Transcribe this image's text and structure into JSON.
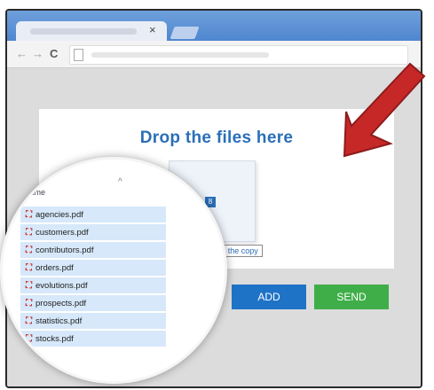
{
  "drop_zone": {
    "title": "Drop the files here",
    "file_chip": "8",
    "copy_hint": "the copy",
    "copy_symbol": "+"
  },
  "buttons": {
    "add": "ADD",
    "send": "SEND"
  },
  "file_list": {
    "header": "Name",
    "files": [
      "agencies.pdf",
      "customers.pdf",
      "contributors.pdf",
      "orders.pdf",
      "evolutions.pdf",
      "prospects.pdf",
      "statistics.pdf",
      "stocks.pdf"
    ]
  },
  "colors": {
    "accent_blue": "#2a6fb8",
    "add_button": "#1f73c7",
    "send_button": "#3fae49",
    "callout_arrow": "#c62828"
  }
}
